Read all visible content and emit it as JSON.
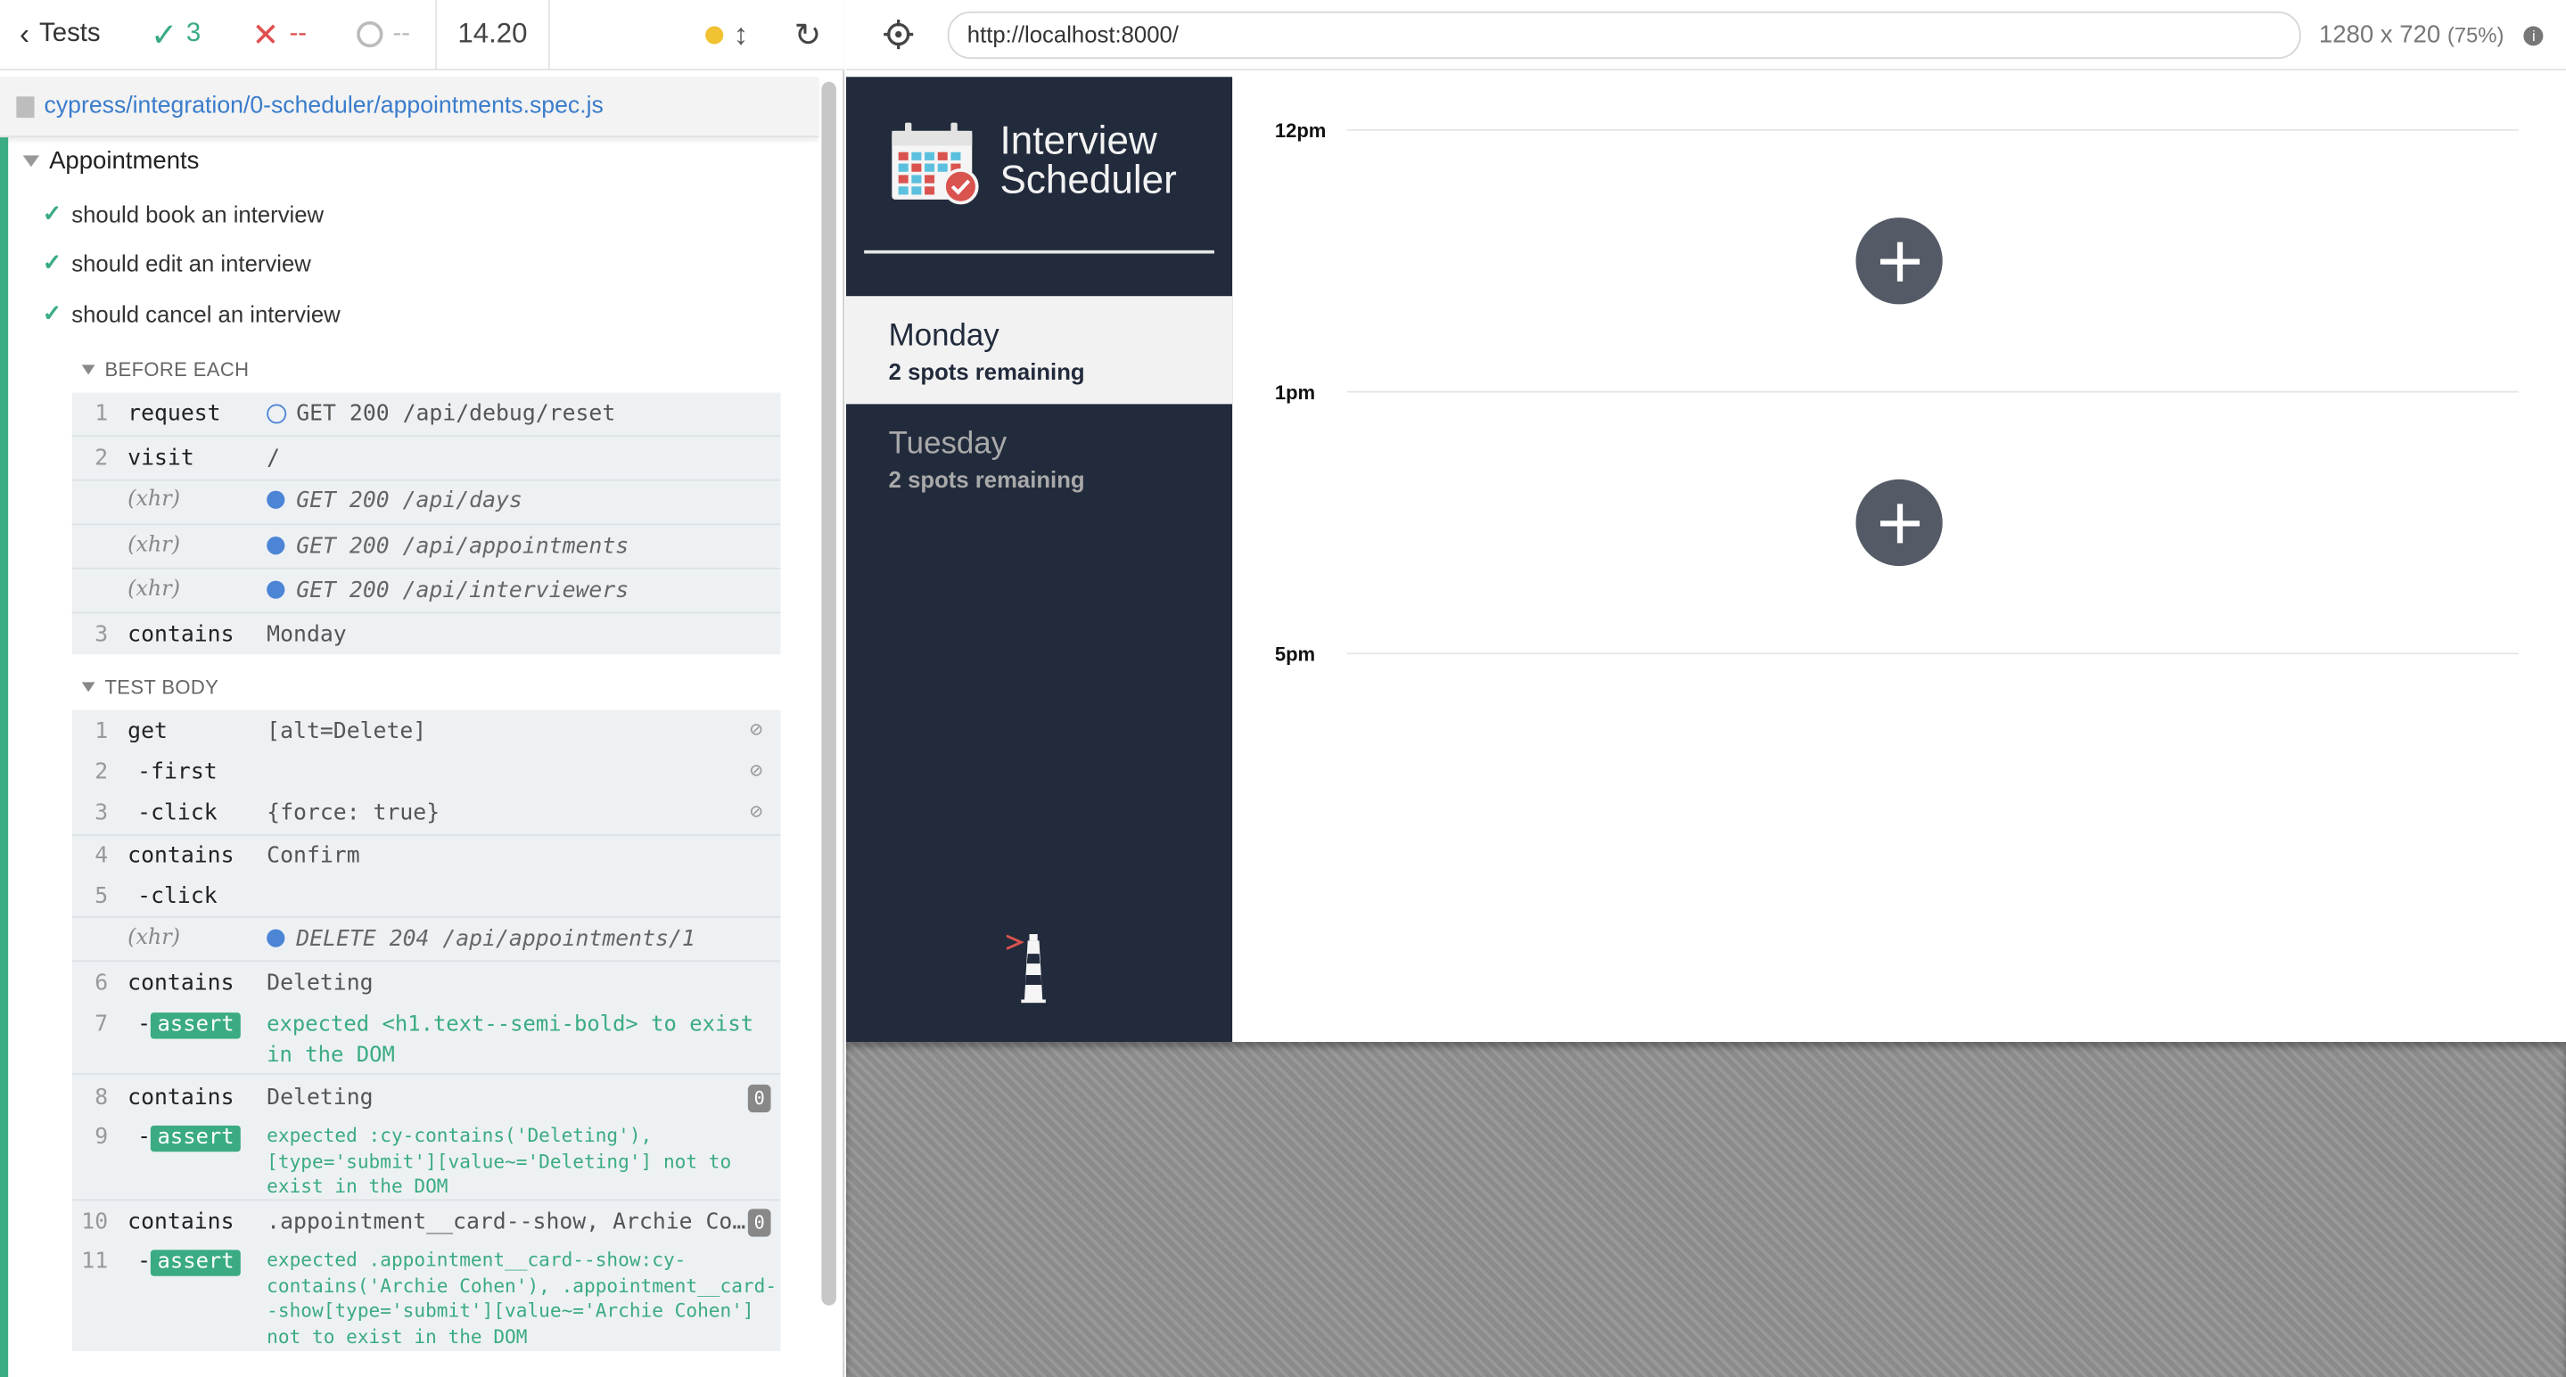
{
  "stats": {
    "tests_label": "Tests",
    "passed": "3",
    "failed": "--",
    "pending": "--",
    "duration": "14.20"
  },
  "spec": {
    "path": "cypress/integration/0-scheduler/appointments.spec.js"
  },
  "suite": {
    "title": "Appointments",
    "tests": [
      "should book an interview",
      "should edit an interview",
      "should cancel an interview"
    ]
  },
  "before_each": {
    "label": "BEFORE EACH",
    "commands": [
      {
        "num": "1",
        "name": "request",
        "msg": "GET 200 /api/debug/reset"
      },
      {
        "num": "2",
        "name": "visit",
        "msg": "/"
      },
      {
        "num": "",
        "name": "(xhr)",
        "msg": "GET 200 /api/days"
      },
      {
        "num": "",
        "name": "(xhr)",
        "msg": "GET 200 /api/appointments"
      },
      {
        "num": "",
        "name": "(xhr)",
        "msg": "GET 200 /api/interviewers"
      },
      {
        "num": "3",
        "name": "contains",
        "msg": "Monday"
      }
    ]
  },
  "test_body": {
    "label": "TEST BODY",
    "commands": [
      {
        "num": "1",
        "name": "get",
        "msg": "[alt=Delete]"
      },
      {
        "num": "2",
        "name": "-first",
        "msg": ""
      },
      {
        "num": "3",
        "name": "-click",
        "msg": "{force: true}"
      },
      {
        "num": "4",
        "name": "contains",
        "msg": "Confirm"
      },
      {
        "num": "5",
        "name": "-click",
        "msg": ""
      },
      {
        "num": "",
        "name": "(xhr)",
        "msg": "DELETE 204 /api/appointments/1"
      },
      {
        "num": "6",
        "name": "contains",
        "msg": "Deleting"
      },
      {
        "num": "7",
        "name": "-",
        "tag": "assert",
        "msg_l1": "expected <h1.text--semi-bold> to exist",
        "msg_l2": "in the DOM"
      },
      {
        "num": "8",
        "name": "contains",
        "msg": "Deleting",
        "badge": "0"
      },
      {
        "num": "9",
        "name": "-",
        "tag": "assert",
        "msg_l1": "expected :cy-contains('Deleting'),",
        "msg_l2": "[type='submit'][value~='Deleting'] not to",
        "msg_l3": "exist in the DOM"
      },
      {
        "num": "10",
        "name": "contains",
        "msg": ".appointment__card--show, Archie Co…",
        "badge": "0"
      },
      {
        "num": "11",
        "name": "-",
        "tag": "assert",
        "msg_l1": "expected .appointment__card--show:cy-",
        "msg_l2": "contains('Archie Cohen'), .appointment__card-",
        "msg_l3": "-show[type='submit'][value~='Archie Cohen']",
        "msg_l4": "not to exist in the DOM"
      }
    ]
  },
  "browser": {
    "url": "http://localhost:8000/",
    "viewport": "1280 x 720",
    "scale": "(75%)"
  },
  "app": {
    "brand_line1": "Interview",
    "brand_line2": "Scheduler",
    "days": [
      {
        "name": "Monday",
        "spots": "2 spots remaining"
      },
      {
        "name": "Tuesday",
        "spots": "2 spots remaining"
      }
    ],
    "slots": [
      "12pm",
      "1pm",
      "5pm"
    ]
  },
  "colors": {
    "pass": "#3aab82",
    "fail": "#e04f4f",
    "sidebar": "#222b3c",
    "add_button": "#545b66"
  }
}
